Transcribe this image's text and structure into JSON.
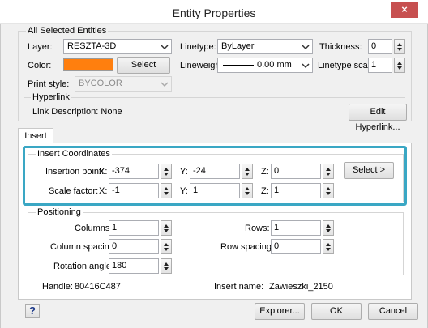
{
  "window": {
    "title": "Entity Properties",
    "close_glyph": "×"
  },
  "all_selected": {
    "group_label": "All Selected Entities",
    "layer": {
      "label": "Layer:",
      "value": "RESZTA-3D"
    },
    "linetype": {
      "label": "Linetype:",
      "value": "ByLayer"
    },
    "thickness": {
      "label": "Thickness:",
      "value": "0"
    },
    "color": {
      "label": "Color:",
      "swatch_color": "#ff7f0e",
      "button": "Select Color..."
    },
    "lineweight": {
      "label": "Lineweight:",
      "value": "0.00 mm"
    },
    "linetype_scale": {
      "label": "Linetype scale:",
      "value": "1"
    },
    "print_style": {
      "label": "Print style:",
      "value": "BYCOLOR"
    },
    "hyperlink": {
      "group_label": "Hyperlink",
      "description": "Link Description: None",
      "button": "Edit Hyperlink..."
    }
  },
  "tabs": [
    {
      "label": "Insert"
    }
  ],
  "insert": {
    "coords_group_label": "Insert Coordinates",
    "insertion_point": {
      "label": "Insertion point:",
      "x_label": "X:",
      "x": "-374",
      "y_label": "Y:",
      "y": "-24",
      "z_label": "Z:",
      "z": "0",
      "select_button": "Select >"
    },
    "scale_factor": {
      "label": "Scale factor:",
      "x_label": "X:",
      "x": "-1",
      "y_label": "Y:",
      "y": "1",
      "z_label": "Z:",
      "z": "1"
    },
    "positioning": {
      "group_label": "Positioning",
      "columns": {
        "label": "Columns:",
        "value": "1"
      },
      "rows": {
        "label": "Rows:",
        "value": "1"
      },
      "column_spacing": {
        "label": "Column spacing:",
        "value": "0"
      },
      "row_spacing": {
        "label": "Row spacing:",
        "value": "0"
      },
      "rotation_angle": {
        "label": "Rotation angle:",
        "value": "180"
      }
    },
    "handle": {
      "label": "Handle:",
      "value": "80416C487"
    },
    "insert_name": {
      "label": "Insert name:",
      "value": "Zawieszki_2150"
    }
  },
  "footer": {
    "help": "?",
    "explorer": "Explorer...",
    "ok": "OK",
    "cancel": "Cancel"
  },
  "colors": {
    "highlight": "#3aa7c4",
    "close": "#c75050"
  }
}
